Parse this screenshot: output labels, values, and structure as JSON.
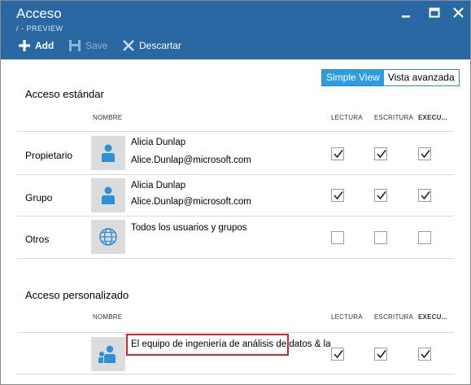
{
  "window": {
    "title": "Acceso",
    "subtitle": "/ - PREVIEW"
  },
  "toolbar": {
    "add_label": "Add",
    "save_label": "Save",
    "discard_label": "Descartar"
  },
  "view_toggle": {
    "simple": "Simple View",
    "advanced": "Vista avanzada",
    "selected": "Simple View"
  },
  "standard": {
    "title": "Acceso estándar",
    "columns": {
      "name": "NOMBRE",
      "read": "LECTURA",
      "write": "ESCRITURA",
      "exec": "EXECU..."
    },
    "rows": [
      {
        "label": "Propietario",
        "name": "Alicia Dunlap",
        "email": "Alice.Dunlap@microsoft.com",
        "icon": "user-icon",
        "read": true,
        "write": true,
        "exec": true
      },
      {
        "label": "Grupo",
        "name": "Alicia Dunlap",
        "email": "Alice.Dunlap@microsoft.com",
        "icon": "user-icon",
        "read": true,
        "write": true,
        "exec": true
      },
      {
        "label": "Otros",
        "name": "Todos los usuarios y grupos",
        "email": "",
        "icon": "globe-icon",
        "read": false,
        "write": false,
        "exec": false
      }
    ]
  },
  "custom": {
    "title": "Acceso personalizado",
    "columns": {
      "name": "NOMBRE",
      "read": "LECTURA",
      "write": "ESCRITURA",
      "exec": "EXECU..."
    },
    "rows": [
      {
        "label": "",
        "name": "El equipo de ingeniería de análisis de datos & la",
        "icon": "group-icon",
        "read": true,
        "write": true,
        "exec": true
      }
    ]
  },
  "colors": {
    "header_bg": "#2a68a4",
    "toggle_active": "#2a9ee0",
    "avatar_icon": "#2f8fd8",
    "highlight_border": "#d9232e"
  }
}
